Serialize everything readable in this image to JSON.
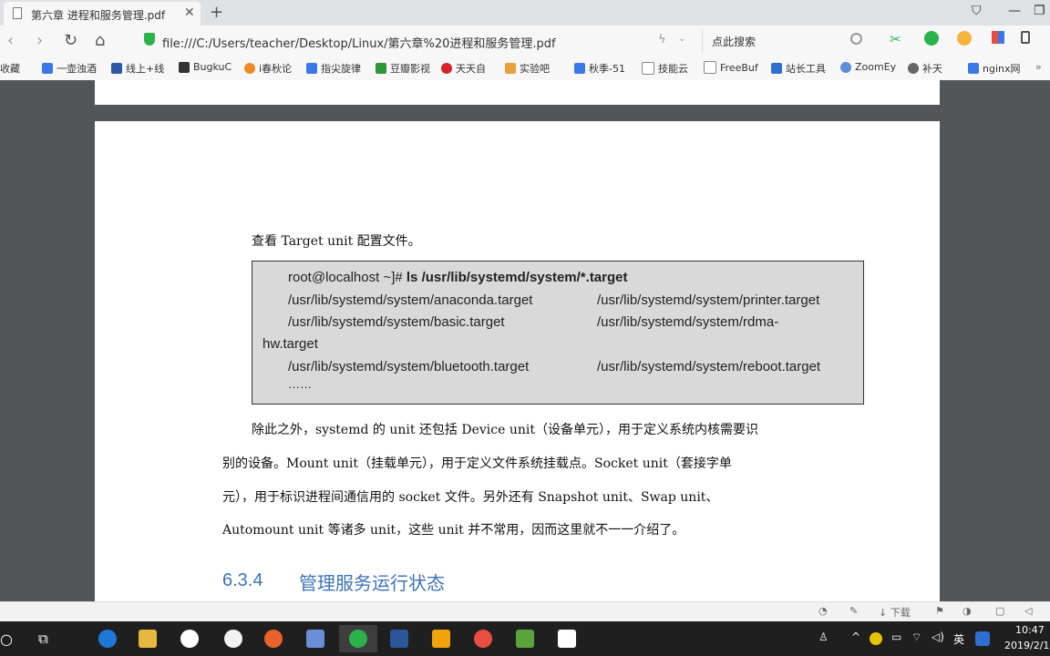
{
  "browser": {
    "tab_title": "第六章 进程和服务管理.pdf",
    "new_tab": "+",
    "url": "file:///C:/Users/teacher/Desktop/Linux/第六章%20进程和服务管理.pdf",
    "search_placeholder": "点此搜索"
  },
  "bookmarks": [
    {
      "label": "收藏",
      "color": "#f3b33d"
    },
    {
      "label": "一壶浊酒",
      "color": "#3b78e7"
    },
    {
      "label": "线上+线",
      "color": "#3056a8"
    },
    {
      "label": "BugkuC",
      "color": "#333333"
    },
    {
      "label": "i春秋论",
      "color": "#f08a24"
    },
    {
      "label": "指尖旋律",
      "color": "#3b78e7"
    },
    {
      "label": "豆瓣影视",
      "color": "#2e963d"
    },
    {
      "label": "天天自",
      "color": "#d8232a"
    },
    {
      "label": "实验吧",
      "color": "#e6a23c"
    },
    {
      "label": "秋季-51",
      "color": "#3b78e7"
    },
    {
      "label": "技能云",
      "color": "#888888"
    },
    {
      "label": "FreeBuf",
      "color": "#888888"
    },
    {
      "label": "站长工具",
      "color": "#2f6fd0"
    },
    {
      "label": "ZoomEy",
      "color": "#5b8dd9"
    },
    {
      "label": "补天",
      "color": "#666666"
    },
    {
      "label": "nginx网",
      "color": "#3b78e7"
    }
  ],
  "pdf": {
    "intro": "查看 Target unit 配置文件。",
    "code": {
      "command_prompt": "root@localhost ~]# ",
      "command": "ls /usr/lib/systemd/system/*.target",
      "row1_left": "/usr/lib/systemd/system/anaconda.target",
      "row1_right": "/usr/lib/systemd/system/printer.target",
      "row2_left": "/usr/lib/systemd/system/basic.target",
      "row2_right": "/usr/lib/systemd/system/rdma-",
      "row2_wrap": "hw.target",
      "row3_left": "/usr/lib/systemd/system/bluetooth.target",
      "row3_right": "/usr/lib/systemd/system/reboot.target",
      "ellipsis": "……"
    },
    "paragraph": [
      "除此之外，systemd 的 unit 还包括 Device unit（设备单元），用于定义系统内核需要识",
      "别的设备。Mount unit（挂载单元），用于定义文件系统挂载点。Socket unit（套接字单",
      "元），用于标识进程间通信用的 socket 文件。另外还有 Snapshot unit、Swap unit、",
      "Automount unit 等诸多 unit，这些 unit 并不常用，因而这里就不一一介绍了。"
    ],
    "section_number": "6.3.4",
    "section_title": "管理服务运行状态"
  },
  "statusbar": {
    "download": "下载"
  },
  "taskbar": {
    "ime": "英",
    "time": "10:47",
    "date": "2019/2/1"
  }
}
